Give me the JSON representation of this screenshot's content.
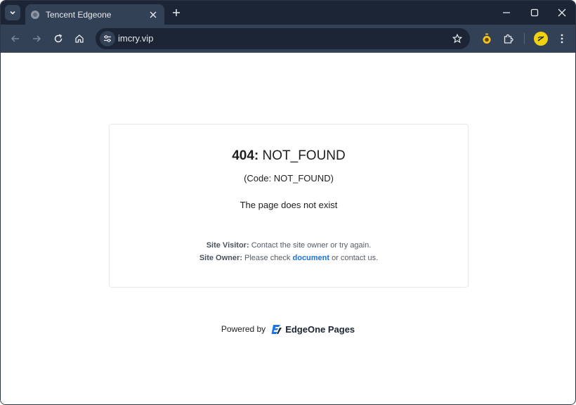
{
  "browser": {
    "tab_title": "Tencent Edgeone",
    "url": "imcry.vip"
  },
  "page": {
    "error_code_bold": "404:",
    "error_code_text": "NOT_FOUND",
    "code_line": "(Code: NOT_FOUND)",
    "message": "The page does not exist",
    "visitor_label": "Site Visitor:",
    "visitor_text": "Contact the site owner or try again.",
    "owner_label": "Site Owner:",
    "owner_text_pre": "Please check",
    "owner_link": "document",
    "owner_text_post": "or contact us.",
    "powered_by": "Powered by",
    "brand_name": "EdgeOne Pages"
  },
  "colors": {
    "tabstrip": "#1b2535",
    "toolbar": "#334156",
    "link": "#1a73e8",
    "avatar": "#f2d10f"
  },
  "icons": [
    "tab-search-icon",
    "globe-favicon-icon",
    "close-icon",
    "plus-icon",
    "minimize-icon",
    "maximize-icon",
    "close-window-icon",
    "back-arrow-icon",
    "forward-arrow-icon",
    "reload-icon",
    "home-icon",
    "site-settings-icon",
    "star-icon",
    "extension-timer-icon",
    "puzzle-icon",
    "profile-avatar-icon",
    "kebab-menu-icon",
    "edgeone-logo-icon"
  ]
}
